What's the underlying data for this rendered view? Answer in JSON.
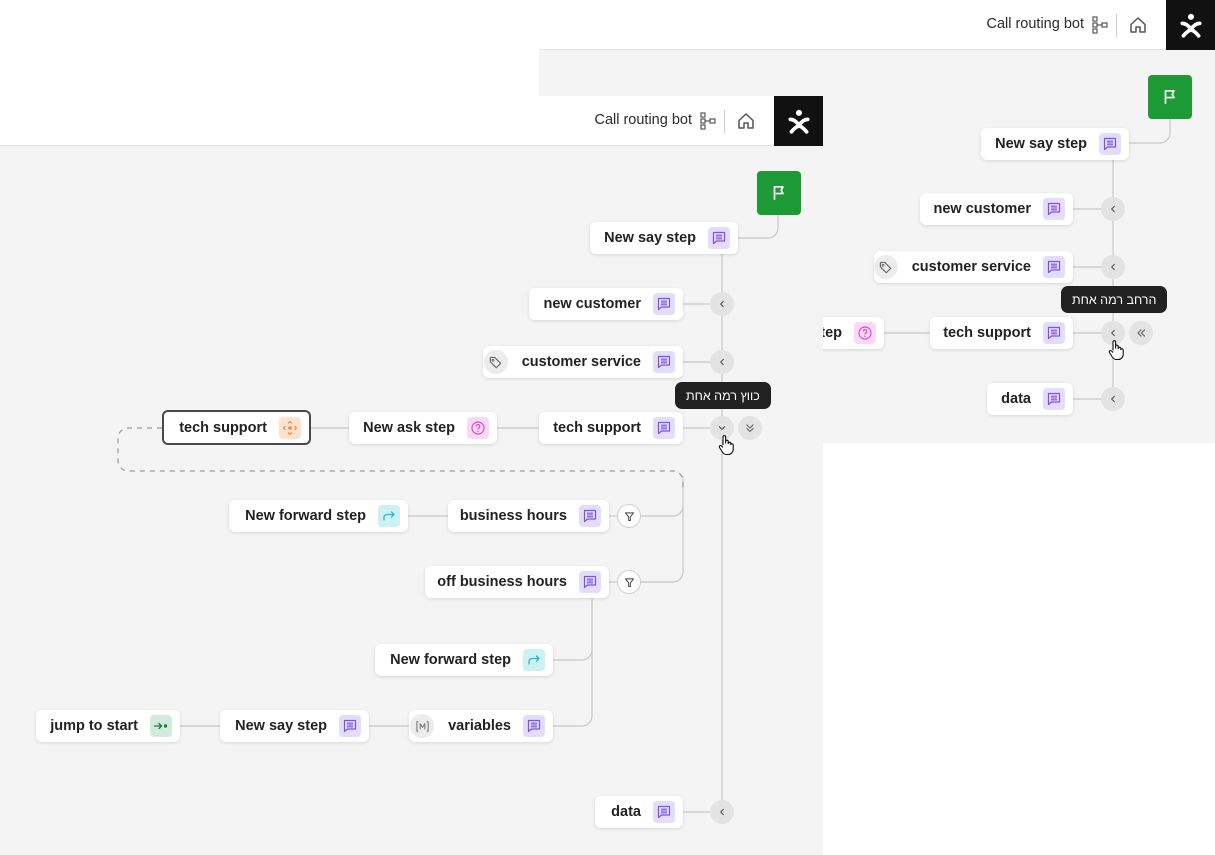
{
  "header": {
    "title": "Call routing bot",
    "icons": {
      "tree": "flow-tree-icon",
      "home": "home-icon",
      "logo": "brand-logo-icon"
    }
  },
  "colors": {
    "start_flag": "#1d9a35",
    "say_icon_bg": "#e3dcfb",
    "ask_icon_bg": "#fbd9f4",
    "forward_icon_bg": "#cdf0f2",
    "jump_icon_bg": "#d4eadc",
    "goto_icon_bg": "#fde2cf",
    "tooltip_bg": "#212121"
  },
  "back_window": {
    "nodes": [
      {
        "label": "New say step",
        "type": "say"
      },
      {
        "label": "new customer",
        "type": "say"
      },
      {
        "label": "customer service",
        "type": "say",
        "lead": "tag"
      },
      {
        "label": "tech support",
        "type": "say"
      },
      {
        "label": "step",
        "type": "ask"
      },
      {
        "label": "data",
        "type": "say"
      }
    ],
    "tooltip": "הרחב רמה אחת"
  },
  "front_window": {
    "nodes": [
      {
        "label": "New say step",
        "type": "say"
      },
      {
        "label": "new customer",
        "type": "say"
      },
      {
        "label": "customer service",
        "type": "say",
        "lead": "tag"
      },
      {
        "label": "tech support",
        "type": "say"
      },
      {
        "label": "New ask step",
        "type": "ask"
      },
      {
        "label": "tech support",
        "type": "goto"
      },
      {
        "label": "business hours",
        "type": "say"
      },
      {
        "label": "New forward step",
        "type": "forward"
      },
      {
        "label": "off business hours",
        "type": "say"
      },
      {
        "label": "New forward step",
        "type": "forward"
      },
      {
        "label": "variables",
        "type": "say",
        "lead": "variable"
      },
      {
        "label": "New say step",
        "type": "say"
      },
      {
        "label": "jump to start",
        "type": "jump"
      },
      {
        "label": "data",
        "type": "say"
      }
    ],
    "tooltip": "כווץ רמה אחת"
  }
}
